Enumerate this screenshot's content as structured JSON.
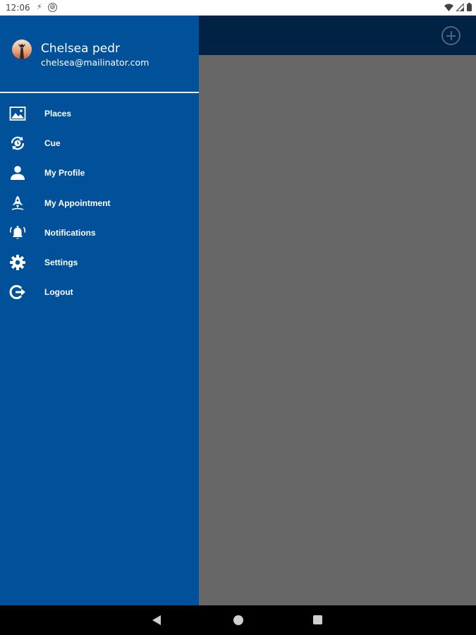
{
  "status_bar": {
    "time": "12:06",
    "notification_icons": [
      "bolt-icon",
      "at-sign-icon"
    ],
    "system_icons": [
      "wifi-icon",
      "signal-icon",
      "battery-icon"
    ]
  },
  "app_bar": {
    "action_icon": "add-circle-icon"
  },
  "drawer": {
    "user": {
      "name": "Chelsea pedr",
      "email": "chelsea@mailinator.com"
    },
    "items": [
      {
        "label": "Places",
        "icon": "image-icon"
      },
      {
        "label": "Cue",
        "icon": "sync-clock-icon"
      },
      {
        "label": "My Profile",
        "icon": "person-icon"
      },
      {
        "label": "My Appointment",
        "icon": "rocket-icon"
      },
      {
        "label": "Notifications",
        "icon": "bell-ring-icon"
      },
      {
        "label": "Settings",
        "icon": "gear-icon"
      },
      {
        "label": "Logout",
        "icon": "logout-icon"
      }
    ]
  },
  "colors": {
    "drawer_bg": "#01519a",
    "app_bar_bg": "#002244",
    "scrim": "#676767",
    "text": "#ffffff"
  },
  "nav_bar": {
    "buttons": [
      "back-icon",
      "home-icon",
      "recents-icon"
    ]
  }
}
